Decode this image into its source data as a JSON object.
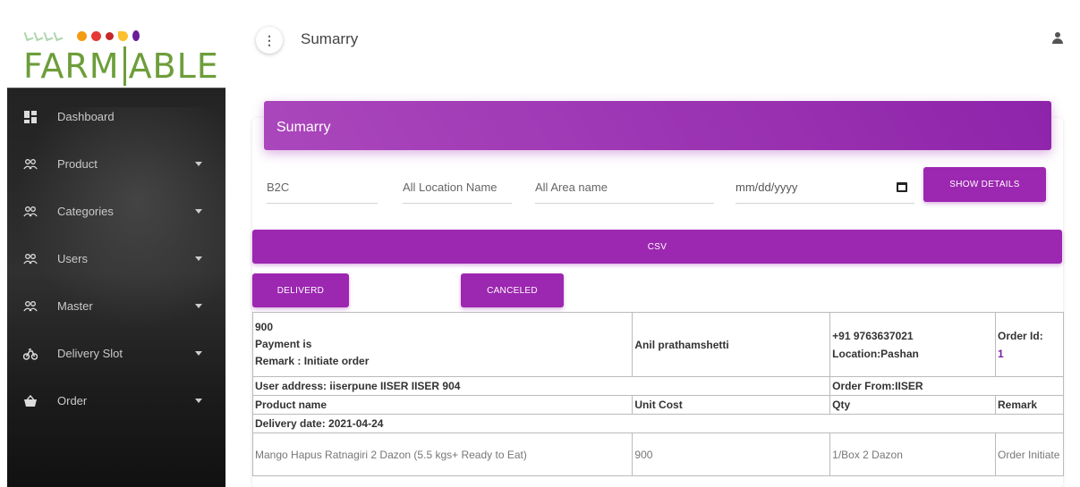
{
  "brand": {
    "logo_text": "FARM TABLE"
  },
  "sidebar": {
    "items": [
      {
        "label": "Dashboard",
        "icon": "dashboard-icon",
        "has_caret": false
      },
      {
        "label": "Product",
        "icon": "people-icon",
        "has_caret": true
      },
      {
        "label": "Categories",
        "icon": "people-icon",
        "has_caret": true
      },
      {
        "label": "Users",
        "icon": "people-icon",
        "has_caret": true
      },
      {
        "label": "Master",
        "icon": "people-icon",
        "has_caret": true
      },
      {
        "label": "Delivery Slot",
        "icon": "bike-icon",
        "has_caret": true
      },
      {
        "label": "Order",
        "icon": "basket-icon",
        "has_caret": true
      }
    ]
  },
  "header": {
    "title": "Sumarry",
    "menu_glyph": "⋮"
  },
  "card": {
    "title": "Sumarry"
  },
  "filters": {
    "type": "B2C",
    "location": "All Location Name",
    "area": "All Area name",
    "date_placeholder": "mm/dd/yyyy",
    "show_details_label": "SHOW DETAILS"
  },
  "buttons": {
    "csv": "CSV",
    "delivered": "DELIVERD",
    "canceled": "CANCELED"
  },
  "order": {
    "amount": "900",
    "payment": "Payment is",
    "remark": "Remark : Initiate order",
    "customer": "Anil prathamshetti",
    "phone": "+91 9763637021",
    "location": "Location:Pashan",
    "order_id_label": "Order Id:",
    "order_id": "1",
    "address": "User address: iiserpune IISER IISER 904",
    "order_from": "Order From:IISER",
    "columns": [
      "Product name",
      "Unit Cost",
      "Qty",
      "Remark"
    ],
    "delivery_date": "Delivery date: 2021-04-24",
    "items": [
      {
        "name": "Mango Hapus Ratnagiri 2 Dazon (5.5 kgs+ Ready to Eat)",
        "unit_cost": "900",
        "qty": "1/Box 2 Dazon",
        "remark": "Order Initiate"
      }
    ]
  },
  "colors": {
    "accent": "#9c27b0",
    "sidebar_bg": "#262626",
    "logo_green": "#6d9e3a"
  }
}
